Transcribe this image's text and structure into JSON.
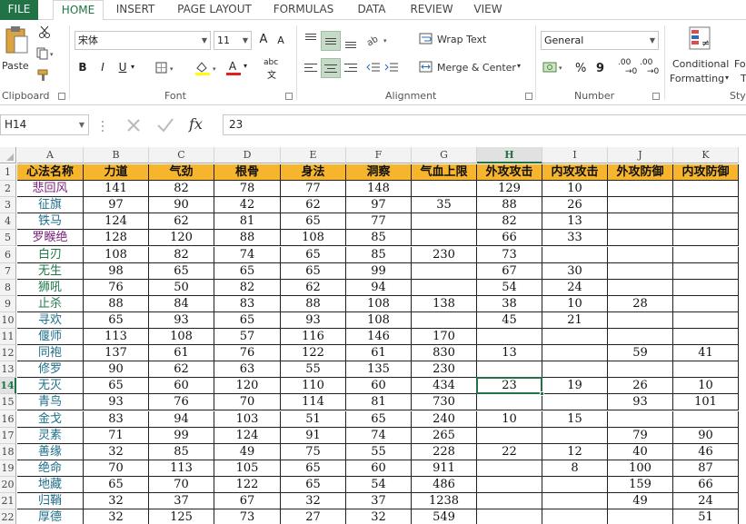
{
  "ribbon_tabs": [
    "FILE",
    "HOME",
    "INSERT",
    "PAGE LAYOUT",
    "FORMULAS",
    "DATA",
    "REVIEW",
    "VIEW"
  ],
  "clipboard": {
    "paste_label": "Paste",
    "group_label": "Clipboard"
  },
  "font": {
    "name": "宋体",
    "size": "11",
    "group_label": "Font",
    "bold": "B",
    "italic": "I",
    "underline": "U",
    "grow": "A",
    "shrink": "A",
    "color_a": "A",
    "phonetic": "abc"
  },
  "alignment": {
    "wrap_text": "Wrap Text",
    "merge_center": "Merge & Center",
    "group_label": "Alignment"
  },
  "number": {
    "format": "General",
    "percent": "%",
    "comma": "9",
    "inc_decimal": ".00",
    "dec_decimal": ".00",
    "group_label": "Number"
  },
  "styles": {
    "conditional_line1": "Conditional",
    "conditional_line2": "Formatting",
    "group_label": "Sty",
    "next_label": "Fo",
    "next_label2": "T"
  },
  "formula_bar": {
    "name_box": "H14",
    "fx": "fx",
    "value": "23"
  },
  "grid": {
    "columns": [
      "A",
      "B",
      "C",
      "D",
      "E",
      "F",
      "G",
      "H",
      "I",
      "J",
      "K"
    ],
    "selected_column": "H",
    "selected_row": "14",
    "header_row": [
      "心法名称",
      "力道",
      "气劲",
      "根骨",
      "身法",
      "洞察",
      "气血上限",
      "外攻攻击",
      "内攻攻击",
      "外攻防御",
      "内攻防御"
    ],
    "name_colors": {
      "悲回风": "#7b1f7b",
      "征旗": "#1f6f8b",
      "铁马": "#1f6f8b",
      "罗睺绝": "#7b1f7b",
      "白刃": "#1f7a4a",
      "无生": "#1f7a4a",
      "狮吼": "#1f7a4a",
      "止杀": "#1f7a4a",
      "寻欢": "#1f6f8b",
      "偃师": "#1f6f8b",
      "同袍": "#1f6f8b",
      "修罗": "#1f6f8b",
      "无灭": "#1f6f8b",
      "青鸟": "#1f6f8b",
      "金戈": "#1f6f8b",
      "灵素": "#1f6f8b",
      "善缘": "#1f6f8b",
      "绝命": "#1f6f8b",
      "地藏": "#1f6f8b",
      "归鞘": "#1f6f8b",
      "厚德": "#1f6f8b"
    },
    "rows": [
      [
        "悲回风",
        "141",
        "82",
        "78",
        "77",
        "148",
        "",
        "129",
        "10",
        "",
        ""
      ],
      [
        "征旗",
        "97",
        "90",
        "42",
        "62",
        "97",
        "35",
        "88",
        "26",
        "",
        ""
      ],
      [
        "铁马",
        "124",
        "62",
        "81",
        "65",
        "77",
        "",
        "82",
        "13",
        "",
        ""
      ],
      [
        "罗睺绝",
        "128",
        "120",
        "88",
        "108",
        "85",
        "",
        "66",
        "33",
        "",
        ""
      ],
      [
        "白刃",
        "108",
        "82",
        "74",
        "65",
        "85",
        "230",
        "73",
        "",
        "",
        ""
      ],
      [
        "无生",
        "98",
        "65",
        "65",
        "65",
        "99",
        "",
        "67",
        "30",
        "",
        ""
      ],
      [
        "狮吼",
        "76",
        "50",
        "82",
        "62",
        "94",
        "",
        "54",
        "24",
        "",
        ""
      ],
      [
        "止杀",
        "88",
        "84",
        "83",
        "88",
        "108",
        "138",
        "38",
        "10",
        "28",
        ""
      ],
      [
        "寻欢",
        "65",
        "93",
        "65",
        "93",
        "108",
        "",
        "45",
        "21",
        "",
        ""
      ],
      [
        "偃师",
        "113",
        "108",
        "57",
        "116",
        "146",
        "170",
        "",
        "",
        "",
        ""
      ],
      [
        "同袍",
        "137",
        "61",
        "76",
        "122",
        "61",
        "830",
        "13",
        "",
        "59",
        "41"
      ],
      [
        "修罗",
        "90",
        "62",
        "63",
        "55",
        "135",
        "230",
        "",
        "",
        "",
        ""
      ],
      [
        "无灭",
        "65",
        "60",
        "120",
        "110",
        "60",
        "434",
        "23",
        "19",
        "26",
        "10"
      ],
      [
        "青鸟",
        "93",
        "76",
        "70",
        "114",
        "81",
        "730",
        "",
        "",
        "93",
        "101"
      ],
      [
        "金戈",
        "83",
        "94",
        "103",
        "51",
        "65",
        "240",
        "10",
        "15",
        "",
        ""
      ],
      [
        "灵素",
        "71",
        "99",
        "124",
        "91",
        "74",
        "265",
        "",
        "",
        "79",
        "90"
      ],
      [
        "善缘",
        "32",
        "85",
        "49",
        "75",
        "55",
        "228",
        "22",
        "12",
        "40",
        "46"
      ],
      [
        "绝命",
        "70",
        "113",
        "105",
        "65",
        "60",
        "911",
        "",
        "8",
        "100",
        "87"
      ],
      [
        "地藏",
        "65",
        "70",
        "122",
        "65",
        "54",
        "486",
        "",
        "",
        "159",
        "66"
      ],
      [
        "归鞘",
        "32",
        "37",
        "67",
        "32",
        "37",
        "1238",
        "",
        "",
        "49",
        "24"
      ],
      [
        "厚德",
        "32",
        "125",
        "73",
        "27",
        "32",
        "549",
        "",
        "",
        "",
        "51"
      ]
    ]
  }
}
